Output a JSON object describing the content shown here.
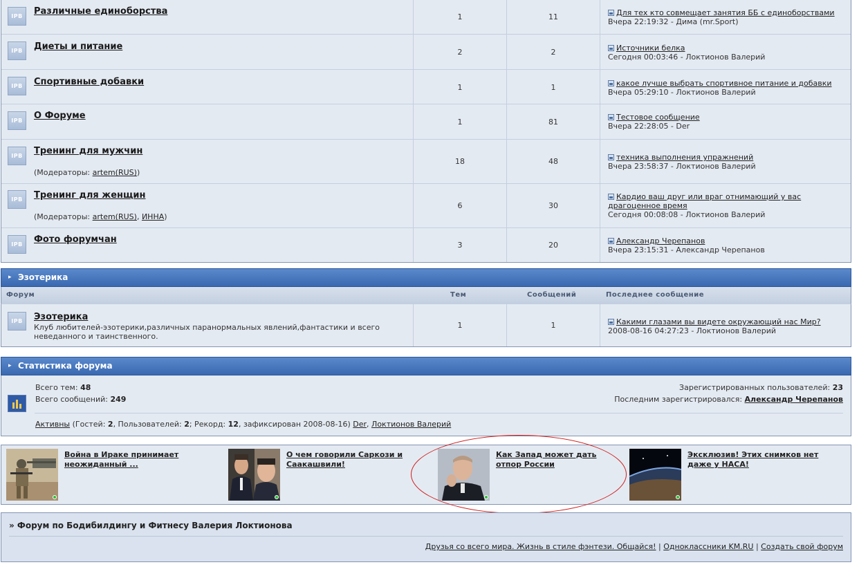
{
  "forums_top": [
    {
      "title": "Различные единоборства",
      "moderators_label": "",
      "topics": "1",
      "posts": "11",
      "last_title": "Для тех кто совмещает занятия ББ с единоборствами",
      "last_meta": "Вчера 22:19:32 - Дима (mr.Sport)"
    },
    {
      "title": "Диеты и питание",
      "topics": "2",
      "posts": "2",
      "last_title": "Источники белка",
      "last_meta": "Сегодня 00:03:46 - Локтионов Валерий"
    },
    {
      "title": "Спортивные добавки",
      "topics": "1",
      "posts": "1",
      "last_title": "какое лучше выбрать спортивное питание и добавки",
      "last_meta": "Вчера 05:29:10 - Локтионов Валерий"
    },
    {
      "title": "О Форуме",
      "topics": "1",
      "posts": "81",
      "last_title": "Тестовое сообщение",
      "last_meta": "Вчера 22:28:05 - Der"
    },
    {
      "title": "Тренинг для мужчин",
      "mods_prefix": "(Модераторы: ",
      "mods": [
        "artem(RUS)"
      ],
      "mods_suffix": ")",
      "topics": "18",
      "posts": "48",
      "last_title": "техника выполнения упражнений",
      "last_meta": "Вчера 23:58:37 - Локтионов Валерий"
    },
    {
      "title": "Тренинг для женщин",
      "mods_prefix": "(Модераторы: ",
      "mods": [
        "artem(RUS)",
        "ИННА"
      ],
      "mods_sep": ", ",
      "mods_suffix": ")",
      "topics": "6",
      "posts": "30",
      "last_title": "Кардио ваш друг или враг отнимающий у вас драгоценное время",
      "last_meta": "Сегодня 00:08:08 - Локтионов Валерий"
    },
    {
      "title": "Фото форумчан",
      "topics": "3",
      "posts": "20",
      "last_title": "Александр Черепанов",
      "last_meta": "Вчера 23:15:31 - Александр Черепанов"
    }
  ],
  "icon_label": "IPB",
  "esoteric": {
    "header": "Эзотерика",
    "columns": {
      "forum": "Форум",
      "topics": "Тем",
      "posts": "Сообщений",
      "last": "Последнее сообщение"
    },
    "forum": {
      "title": "Эзотерика",
      "desc": "Клуб любителей-эзотерики,различных паранормальных явлений,фантастики и всего неведанного и таинственного.",
      "topics": "1",
      "posts": "1",
      "last_title": "Какими глазами вы видете окружающий нас Мир?",
      "last_meta": "2008-08-16 04:27:23 - Локтионов Валерий"
    }
  },
  "stats": {
    "header": "Статистика форума",
    "total_topics_label": "Всего тем:",
    "total_topics": "48",
    "total_posts_label": "Всего сообщений:",
    "total_posts": "249",
    "registered_label": "Зарегистрированных пользователей:",
    "registered": "23",
    "last_registered_label": "Последним зарегистрировался:",
    "last_registered": "Александр Черепанов",
    "active_link": "Активны",
    "active_guests_label": " (Гостей: ",
    "guests": "2",
    "users_label": ", Пользователей: ",
    "users": "2",
    "record_label": "; Рекорд: ",
    "record": "12",
    "record_date": ", зафиксирован 2008-08-16)",
    "active_users": [
      "Der",
      "Локтионов Валерий"
    ]
  },
  "news": [
    {
      "text": "Война в Ираке принимает неожиданный ...",
      "icon": "soldier-photo"
    },
    {
      "text": "О чем говорили Саркози и Саакашвили!",
      "icon": "politicians-photo"
    },
    {
      "text": "Как Запад может дать отпор России",
      "icon": "portrait-photo"
    },
    {
      "text": "Эксклюзив! Этих снимков нет даже у НАСА!",
      "icon": "earth-space-photo"
    }
  ],
  "footer": {
    "title": "» Форум по Бодибилдингу и Фитнесу Валерия Локтионова",
    "links": [
      "Друзья со всего мира. Жизнь в стиле фэнтези. Общайся!",
      "Одноклассники KM.RU",
      "Создать свой форум"
    ],
    "sep": " | "
  },
  "colors": {
    "header_blue": "#3a69b1",
    "row_bg": "#e4eaf2",
    "border": "#8394b2",
    "annotation_red": "#d01c1c"
  }
}
